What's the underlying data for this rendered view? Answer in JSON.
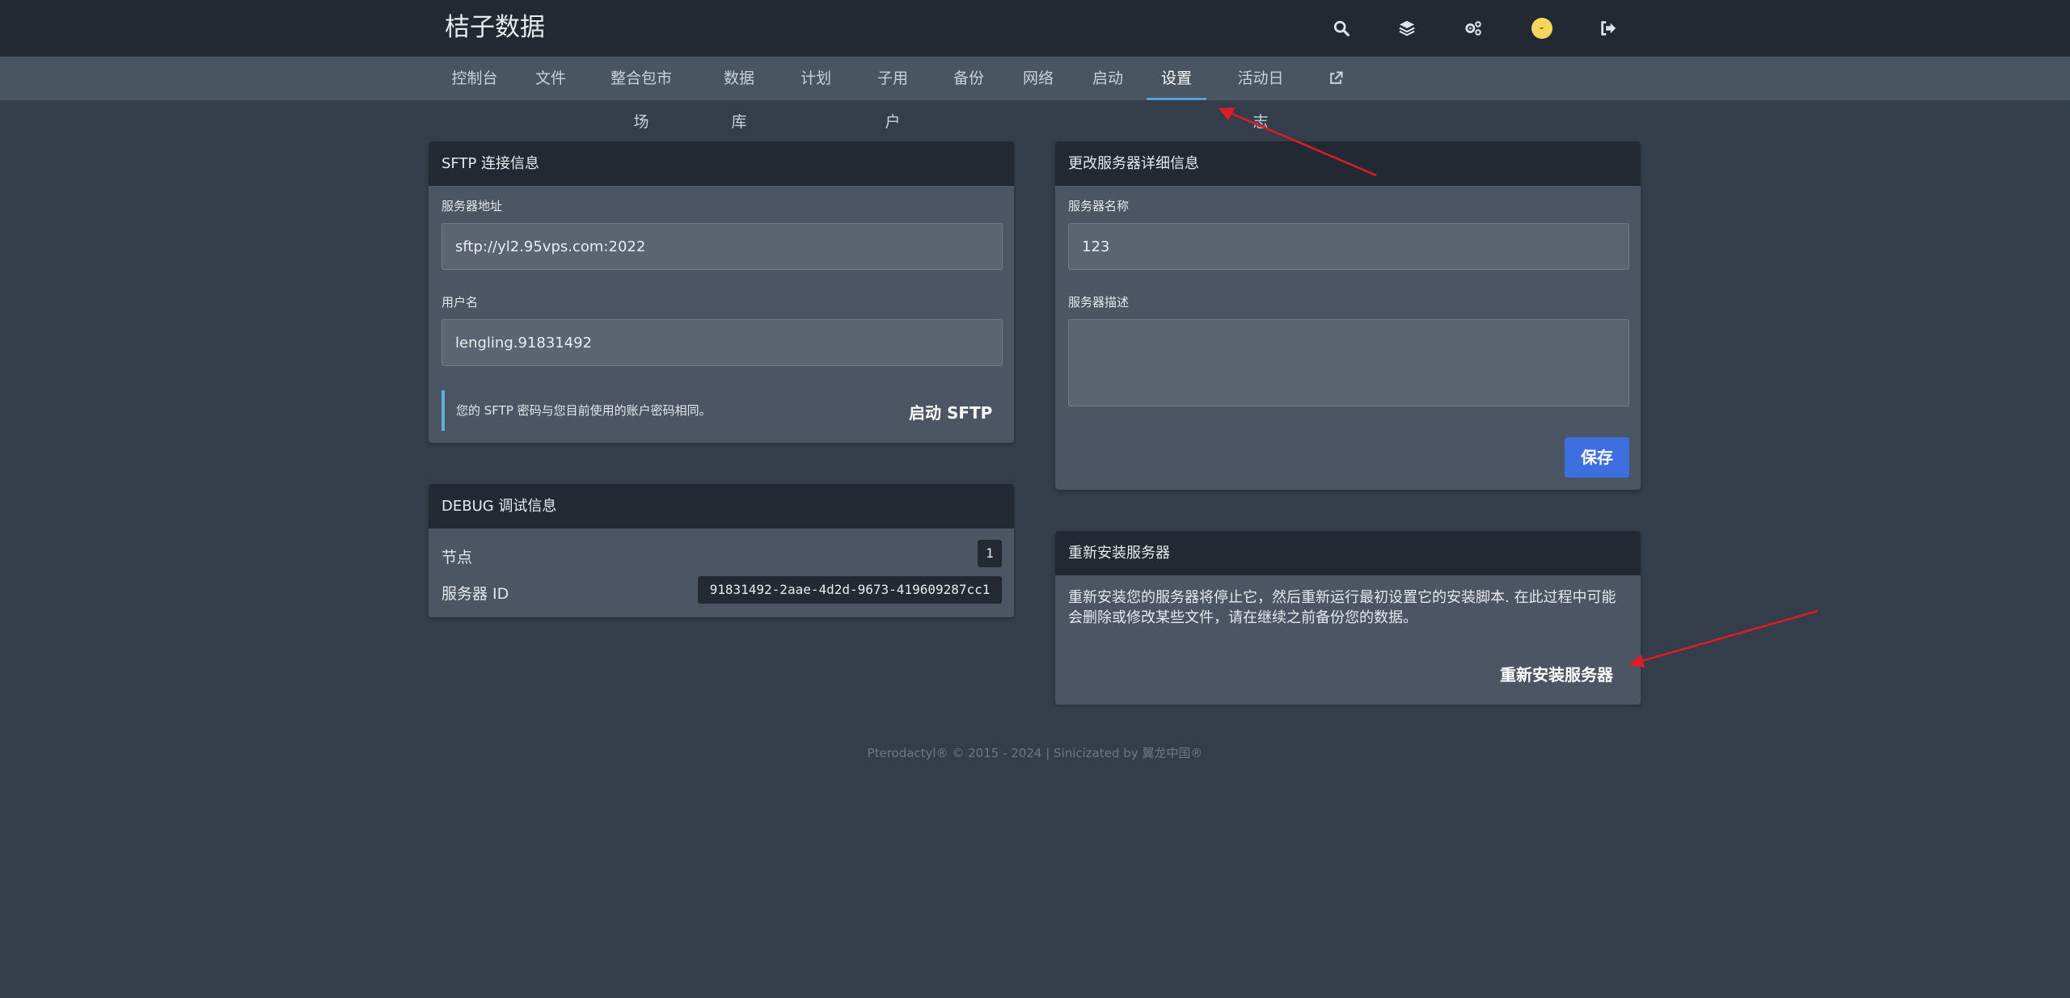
{
  "header": {
    "brand": "桔子数据",
    "icons": [
      "search-icon",
      "layers-icon",
      "settings-icon",
      "avatar-icon",
      "logout-icon"
    ]
  },
  "nav": {
    "tabs": [
      {
        "label": "控制台"
      },
      {
        "label": "文件"
      },
      {
        "label": "整合包市场"
      },
      {
        "label": "数据库"
      },
      {
        "label": "计划"
      },
      {
        "label": "子用户"
      },
      {
        "label": "备份"
      },
      {
        "label": "网络"
      },
      {
        "label": "启动"
      },
      {
        "label": "设置",
        "active": true
      },
      {
        "label": "活动日志"
      }
    ],
    "external_icon": "external-link-icon"
  },
  "sftp": {
    "title": "SFTP 连接信息",
    "address_label": "服务器地址",
    "address_value": "sftp://yl2.95vps.com:2022",
    "username_label": "用户名",
    "username_value": "lengling.91831492",
    "note": "您的 SFTP 密码与您目前使用的账户密码相同。",
    "launch_button": "启动 SFTP"
  },
  "debug": {
    "title": "DEBUG 调试信息",
    "node_label": "节点",
    "node_value": "1",
    "server_id_label": "服务器 ID",
    "server_id_value": "91831492-2aae-4d2d-9673-419609287cc1"
  },
  "details": {
    "title": "更改服务器详细信息",
    "name_label": "服务器名称",
    "name_value": "123",
    "desc_label": "服务器描述",
    "desc_value": "",
    "save_button": "保存"
  },
  "reinstall": {
    "title": "重新安装服务器",
    "description": "重新安装您的服务器将停止它，然后重新运行最初设置它的安装脚本. 在此过程中可能会删除或修改某些文件，请在继续之前备份您的数据。",
    "button": "重新安装服务器"
  },
  "footer": {
    "text": "Pterodactyl® © 2015 - 2024 | Sinicizated by 翼龙中国®"
  },
  "colors": {
    "accent": "#3e6fe0",
    "annotation_arrow": "#e01b24",
    "active_tab_underline": "#5aa0d8"
  }
}
